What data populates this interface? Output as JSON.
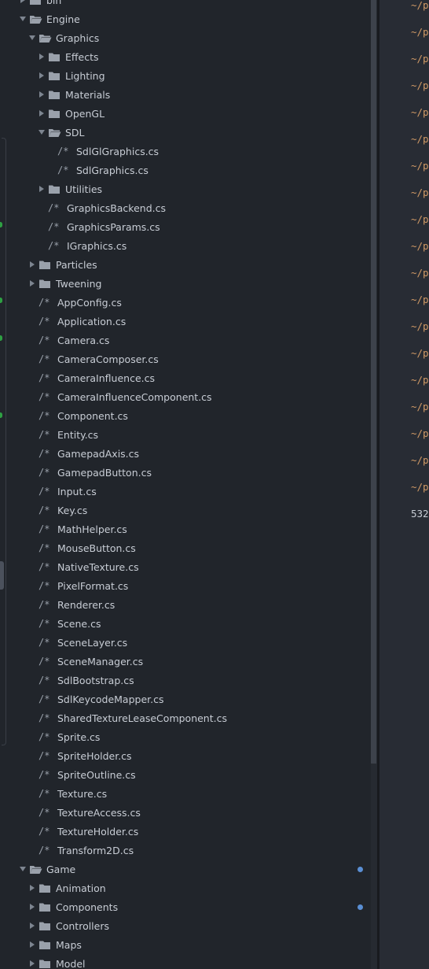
{
  "tree": {
    "rows": [
      {
        "depth": 0,
        "type": "folder",
        "expanded": false,
        "label": "bin",
        "modified": false
      },
      {
        "depth": 0,
        "type": "folder",
        "expanded": true,
        "label": "Engine",
        "modified": false
      },
      {
        "depth": 1,
        "type": "folder",
        "expanded": true,
        "label": "Graphics",
        "modified": false
      },
      {
        "depth": 2,
        "type": "folder",
        "expanded": false,
        "label": "Effects",
        "modified": false
      },
      {
        "depth": 2,
        "type": "folder",
        "expanded": false,
        "label": "Lighting",
        "modified": false
      },
      {
        "depth": 2,
        "type": "folder",
        "expanded": false,
        "label": "Materials",
        "modified": false
      },
      {
        "depth": 2,
        "type": "folder",
        "expanded": false,
        "label": "OpenGL",
        "modified": false
      },
      {
        "depth": 2,
        "type": "folder",
        "expanded": true,
        "label": "SDL",
        "modified": false
      },
      {
        "depth": 3,
        "type": "file",
        "label": "SdlGlGraphics.cs",
        "modified": false
      },
      {
        "depth": 3,
        "type": "file",
        "label": "SdlGraphics.cs",
        "modified": false
      },
      {
        "depth": 2,
        "type": "folder",
        "expanded": false,
        "label": "Utilities",
        "modified": false
      },
      {
        "depth": 2,
        "type": "file",
        "label": "GraphicsBackend.cs",
        "modified": false
      },
      {
        "depth": 2,
        "type": "file",
        "label": "GraphicsParams.cs",
        "modified": false
      },
      {
        "depth": 2,
        "type": "file",
        "label": "IGraphics.cs",
        "modified": false
      },
      {
        "depth": 1,
        "type": "folder",
        "expanded": false,
        "label": "Particles",
        "modified": false
      },
      {
        "depth": 1,
        "type": "folder",
        "expanded": false,
        "label": "Tweening",
        "modified": false
      },
      {
        "depth": 1,
        "type": "file",
        "label": "AppConfig.cs",
        "modified": false
      },
      {
        "depth": 1,
        "type": "file",
        "label": "Application.cs",
        "modified": false
      },
      {
        "depth": 1,
        "type": "file",
        "label": "Camera.cs",
        "modified": false
      },
      {
        "depth": 1,
        "type": "file",
        "label": "CameraComposer.cs",
        "modified": false
      },
      {
        "depth": 1,
        "type": "file",
        "label": "CameraInfluence.cs",
        "modified": false
      },
      {
        "depth": 1,
        "type": "file",
        "label": "CameraInfluenceComponent.cs",
        "modified": false
      },
      {
        "depth": 1,
        "type": "file",
        "label": "Component.cs",
        "modified": false
      },
      {
        "depth": 1,
        "type": "file",
        "label": "Entity.cs",
        "modified": false
      },
      {
        "depth": 1,
        "type": "file",
        "label": "GamepadAxis.cs",
        "modified": false
      },
      {
        "depth": 1,
        "type": "file",
        "label": "GamepadButton.cs",
        "modified": false
      },
      {
        "depth": 1,
        "type": "file",
        "label": "Input.cs",
        "modified": false
      },
      {
        "depth": 1,
        "type": "file",
        "label": "Key.cs",
        "modified": false
      },
      {
        "depth": 1,
        "type": "file",
        "label": "MathHelper.cs",
        "modified": false
      },
      {
        "depth": 1,
        "type": "file",
        "label": "MouseButton.cs",
        "modified": false
      },
      {
        "depth": 1,
        "type": "file",
        "label": "NativeTexture.cs",
        "modified": false
      },
      {
        "depth": 1,
        "type": "file",
        "label": "PixelFormat.cs",
        "modified": false
      },
      {
        "depth": 1,
        "type": "file",
        "label": "Renderer.cs",
        "modified": false
      },
      {
        "depth": 1,
        "type": "file",
        "label": "Scene.cs",
        "modified": false
      },
      {
        "depth": 1,
        "type": "file",
        "label": "SceneLayer.cs",
        "modified": false
      },
      {
        "depth": 1,
        "type": "file",
        "label": "SceneManager.cs",
        "modified": false
      },
      {
        "depth": 1,
        "type": "file",
        "label": "SdlBootstrap.cs",
        "modified": false
      },
      {
        "depth": 1,
        "type": "file",
        "label": "SdlKeycodeMapper.cs",
        "modified": false
      },
      {
        "depth": 1,
        "type": "file",
        "label": "SharedTextureLeaseComponent.cs",
        "modified": false
      },
      {
        "depth": 1,
        "type": "file",
        "label": "Sprite.cs",
        "modified": false
      },
      {
        "depth": 1,
        "type": "file",
        "label": "SpriteHolder.cs",
        "modified": false
      },
      {
        "depth": 1,
        "type": "file",
        "label": "SpriteOutline.cs",
        "modified": false
      },
      {
        "depth": 1,
        "type": "file",
        "label": "Texture.cs",
        "modified": false
      },
      {
        "depth": 1,
        "type": "file",
        "label": "TextureAccess.cs",
        "modified": false
      },
      {
        "depth": 1,
        "type": "file",
        "label": "TextureHolder.cs",
        "modified": false
      },
      {
        "depth": 1,
        "type": "file",
        "label": "Transform2D.cs",
        "modified": false
      },
      {
        "depth": 0,
        "type": "folder",
        "expanded": true,
        "label": "Game",
        "modified": true
      },
      {
        "depth": 1,
        "type": "folder",
        "expanded": false,
        "label": "Animation",
        "modified": false
      },
      {
        "depth": 1,
        "type": "folder",
        "expanded": false,
        "label": "Components",
        "modified": true
      },
      {
        "depth": 1,
        "type": "folder",
        "expanded": false,
        "label": "Controllers",
        "modified": false
      },
      {
        "depth": 1,
        "type": "folder",
        "expanded": false,
        "label": "Maps",
        "modified": false
      },
      {
        "depth": 1,
        "type": "folder",
        "expanded": false,
        "label": "Model",
        "modified": false
      }
    ],
    "file_glyph": "/*",
    "folder_icon": "folder-icon",
    "open_folder_icon": "folder-open-icon",
    "colors": {
      "text": "#c8cdd5",
      "folder": "#9aa1ab",
      "modified_dot": "#5a8fd4"
    }
  },
  "editor": {
    "lines": [
      "~/p",
      "~/p",
      "~/p",
      "~/p",
      "~/p",
      "~/p",
      "~/p",
      "~/p",
      "~/p",
      "~/p",
      "~/p",
      "~/p",
      "~/p",
      "~/p",
      "~/p",
      "~/p",
      "~/p",
      "~/p",
      "~/p",
      "532"
    ],
    "colors": {
      "path": "#d19a66",
      "plain": "#c8cdd5"
    }
  }
}
